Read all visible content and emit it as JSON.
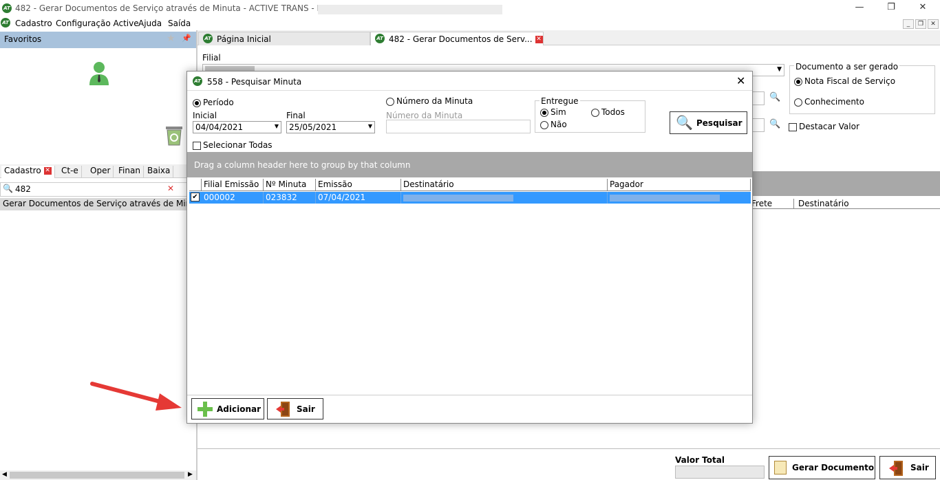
{
  "window": {
    "title": "482 - Gerar Documentos de Serviço através de Minuta - ACTIVE TRANS - EMPRESA:",
    "logo": "AT"
  },
  "menu": [
    "Cadastro",
    "Configuração Active",
    "Ajuda",
    "Saída"
  ],
  "left_panel": {
    "favoritos_label": "Favoritos",
    "tabs": [
      "Cadastro",
      "Ct-e",
      "Oper",
      "Finan",
      "Baixa"
    ],
    "search_value": "482",
    "tree_item": "Gerar Documentos de Serviço através de Minuta"
  },
  "main_tabs": [
    "Página Inicial",
    "482 - Gerar Documentos de Serv..."
  ],
  "main": {
    "filial_label": "Filial",
    "documento_group": "Documento a ser gerado",
    "doc_options": [
      "Nota Fiscal de Serviço",
      "Conhecimento"
    ],
    "destacar_label": "Destacar Valor",
    "bg_headers": [
      "Frete",
      "Destinatário"
    ],
    "valor_total_label": "Valor Total",
    "gerar_label": "Gerar Documento",
    "sair_label": "Sair"
  },
  "dialog": {
    "title": "558 - Pesquisar Minuta",
    "periodo_label": "Período",
    "numero_radio_label": "Número da Minuta",
    "inicial_label": "Inicial",
    "final_label": "Final",
    "inicial_value": "04/04/2021",
    "final_value": "25/05/2021",
    "numero_field_label": "Número da Minuta",
    "entregue_label": "Entregue",
    "entregue_options": [
      "Sim",
      "Todos",
      "Não"
    ],
    "pesquisar_label": "Pesquisar",
    "selecionar_label": "Selecionar Todas",
    "group_hint": "Drag a column header here to group by that column",
    "columns": [
      "Filial Emissão",
      "Nº Minuta",
      "Emissão",
      "Destinatário",
      "Pagador"
    ],
    "rows": [
      {
        "filial": "000002",
        "minuta": "023832",
        "emissao": "07/04/2021",
        "checked": "✔"
      }
    ],
    "adicionar_label": "Adicionar",
    "sair_label": "Sair"
  },
  "colors": {
    "accent_blue": "#3399ff",
    "header_blue": "#a8c2dc",
    "group_gray": "#a8a8a8",
    "annotation_red": "#e53935"
  }
}
